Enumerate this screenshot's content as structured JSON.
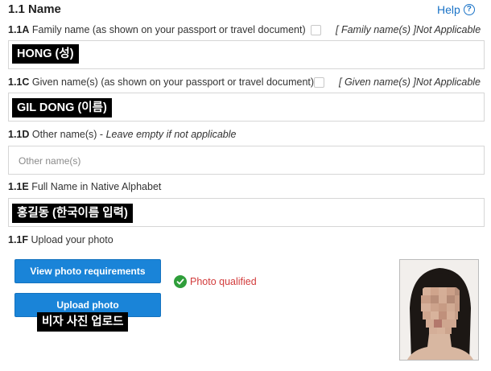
{
  "section": {
    "title": "1.1 Name",
    "help_label": "Help",
    "help_icon": "question-circle-icon"
  },
  "family_name": {
    "num": "1.1A",
    "label": " Family name (as shown on your passport or travel document)",
    "na_label": "[ Family name(s) ]Not Applicable",
    "value": "HONG (성)"
  },
  "given_name": {
    "num": "1.1C",
    "label": " Given name(s) (as shown on your passport or travel document)",
    "na_label": "[ Given name(s) ]Not Applicable",
    "value": "GIL DONG (이름)"
  },
  "other_name": {
    "num": "1.1D",
    "label": " Other name(s) - ",
    "hint": "Leave empty if not applicable",
    "placeholder": "Other name(s)"
  },
  "native_name": {
    "num": "1.1E",
    "label": " Full Name in Native Alphabet",
    "value": "홍길동 (한국이름 입력)"
  },
  "photo": {
    "num": "1.1F",
    "label": " Upload your photo",
    "view_button": "View photo requirements",
    "upload_button": "Upload photo",
    "upload_caption": "비자 사진 업로드",
    "status_text": "Photo qualified",
    "status_icon": "check-circle-icon"
  },
  "colors": {
    "accent": "#1a84d8",
    "link": "#1a73c7",
    "success": "#2e9e3a",
    "status_text": "#d23b3b"
  }
}
